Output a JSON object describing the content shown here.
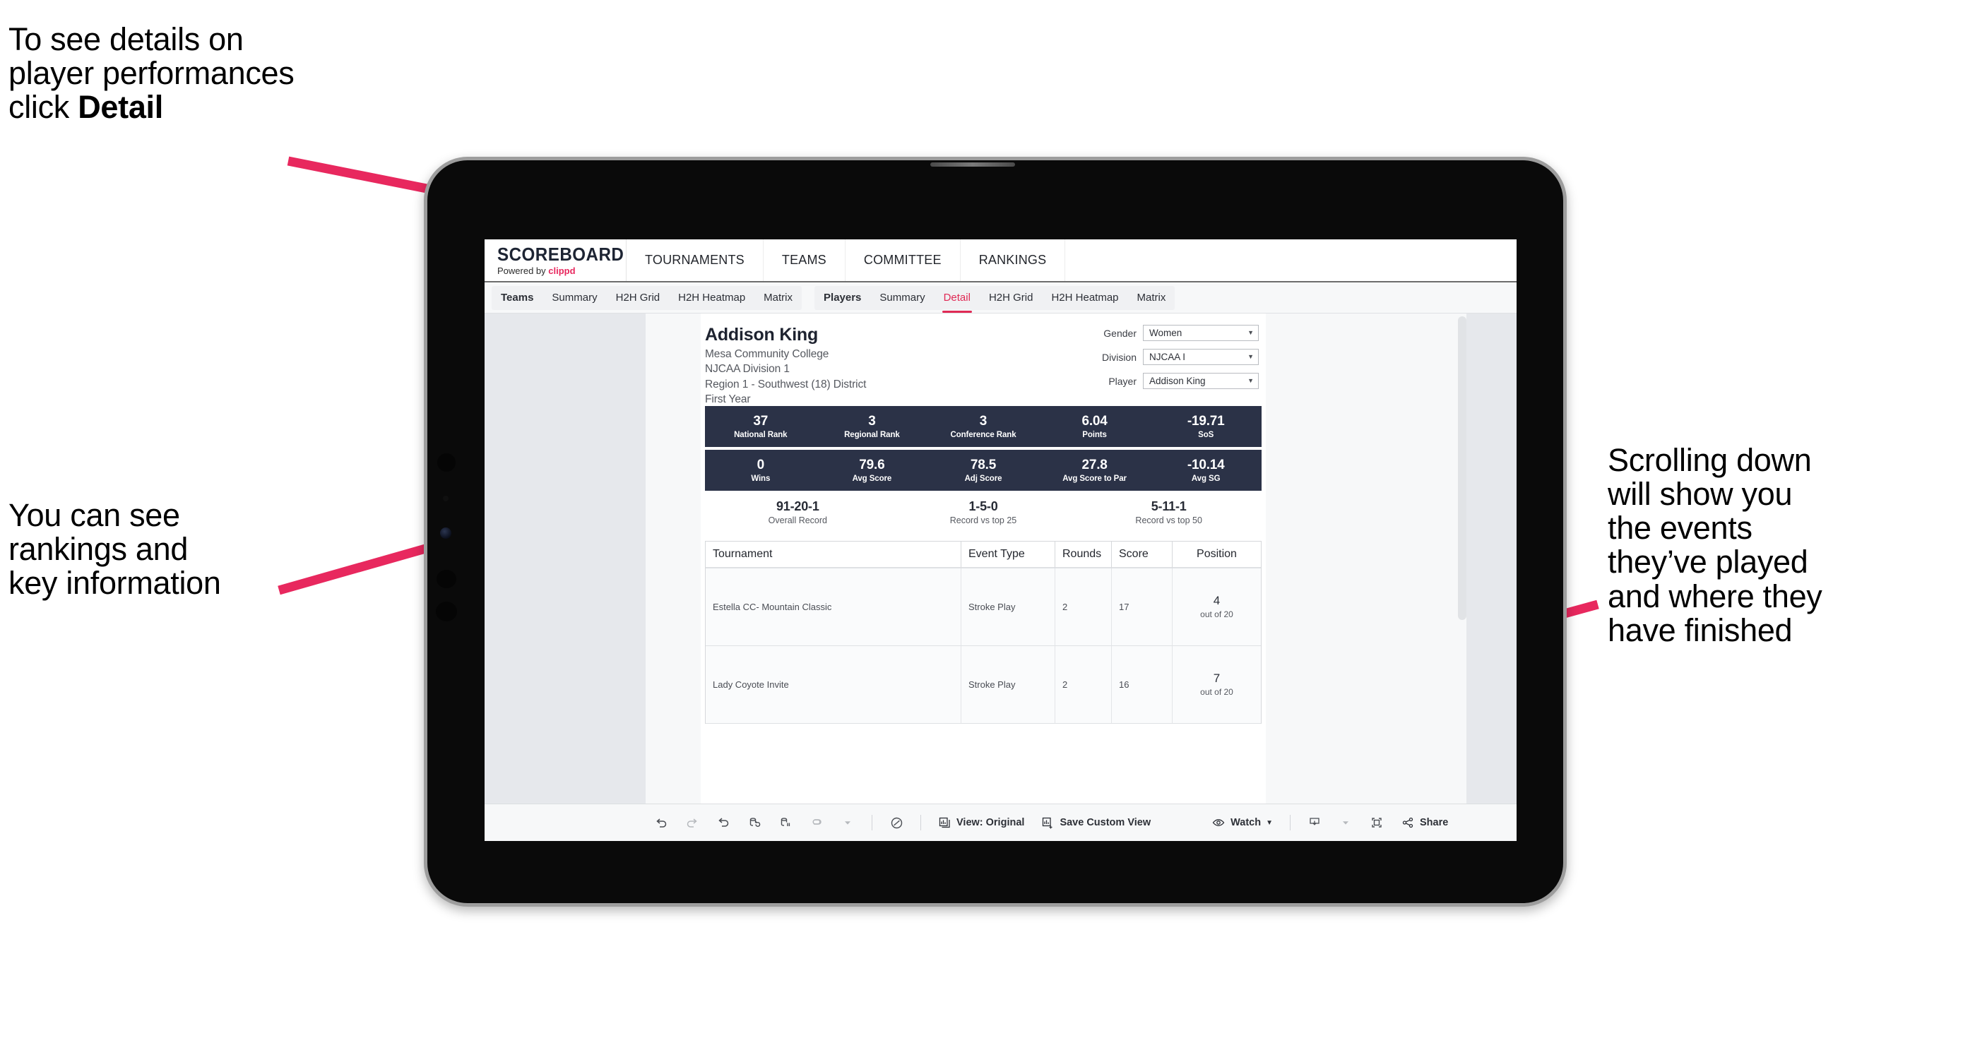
{
  "annotations": {
    "detail": "To see details on\nplayer performances\nclick ",
    "detail_bold": "Detail",
    "rankings": "You can see\nrankings and\nkey information",
    "scrolling": "Scrolling down\nwill show you\nthe events\nthey’ve played\nand where they\nhave finished"
  },
  "colors": {
    "accent_pink": "#e8285e",
    "arrow_pink": "#e8285e",
    "band_navy": "#2b3247",
    "tab_active": "#e02a55"
  },
  "app": {
    "brand": {
      "title": "SCOREBOARD",
      "powered_prefix": "Powered by ",
      "powered_brand": "clippd"
    },
    "topnav": [
      "TOURNAMENTS",
      "TEAMS",
      "COMMITTEE",
      "RANKINGS"
    ],
    "subtabs": {
      "teams_group": [
        "Teams",
        "Summary",
        "H2H Grid",
        "H2H Heatmap",
        "Matrix"
      ],
      "players_group": [
        "Players",
        "Summary",
        "Detail",
        "H2H Grid",
        "H2H Heatmap",
        "Matrix"
      ],
      "active": "Detail"
    }
  },
  "player": {
    "name": "Addison King",
    "school": "Mesa Community College",
    "division": "NJCAA Division 1",
    "region": "Region 1 - Southwest (18) District",
    "year": "First Year"
  },
  "filters": [
    {
      "label": "Gender",
      "value": "Women"
    },
    {
      "label": "Division",
      "value": "NJCAA I"
    },
    {
      "label": "Player",
      "value": "Addison King"
    }
  ],
  "stats_band_1": [
    {
      "value": "37",
      "label": "National Rank"
    },
    {
      "value": "3",
      "label": "Regional Rank"
    },
    {
      "value": "3",
      "label": "Conference Rank"
    },
    {
      "value": "6.04",
      "label": "Points"
    },
    {
      "value": "-19.71",
      "label": "SoS"
    }
  ],
  "stats_band_2": [
    {
      "value": "0",
      "label": "Wins"
    },
    {
      "value": "79.6",
      "label": "Avg Score"
    },
    {
      "value": "78.5",
      "label": "Adj Score"
    },
    {
      "value": "27.8",
      "label": "Avg Score to Par"
    },
    {
      "value": "-10.14",
      "label": "Avg SG"
    }
  ],
  "records": [
    {
      "value": "91-20-1",
      "label": "Overall Record"
    },
    {
      "value": "1-5-0",
      "label": "Record vs top 25"
    },
    {
      "value": "5-11-1",
      "label": "Record vs top 50"
    }
  ],
  "tournaments": {
    "headers": [
      "Tournament",
      "Event Type",
      "Rounds",
      "Score",
      "Position"
    ],
    "rows": [
      {
        "tournament": "Estella CC- Mountain Classic",
        "event_type": "Stroke Play",
        "rounds": "2",
        "score": "17",
        "position": "4",
        "position_sub": "out of 20"
      },
      {
        "tournament": "Lady Coyote Invite",
        "event_type": "Stroke Play",
        "rounds": "2",
        "score": "16",
        "position": "7",
        "position_sub": "out of 20"
      }
    ]
  },
  "toolbar": {
    "view_label": "View: Original",
    "save_label": "Save Custom View",
    "watch_label": "Watch",
    "share_label": "Share"
  }
}
